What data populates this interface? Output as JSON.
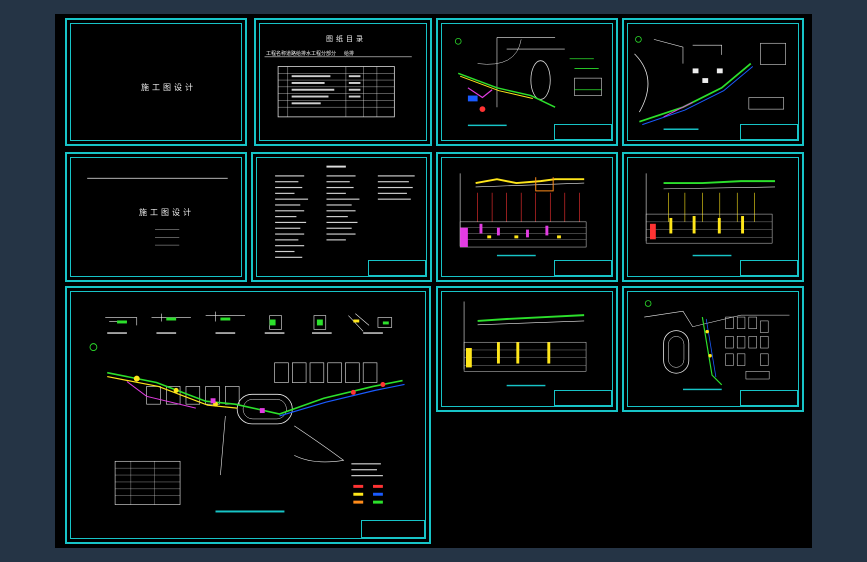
{
  "colors": {
    "background": "#253445",
    "canvas": "#000000",
    "frame": "#17c4c7"
  },
  "sheets": {
    "cover1": {
      "title": "施工图设计"
    },
    "index": {
      "title": "图纸目录",
      "project_label": "工程名称",
      "project": "道路给排水工程",
      "drawing_label": "分部分",
      "drawing": "给排"
    },
    "cover2": {
      "title": "施工图设计"
    }
  }
}
